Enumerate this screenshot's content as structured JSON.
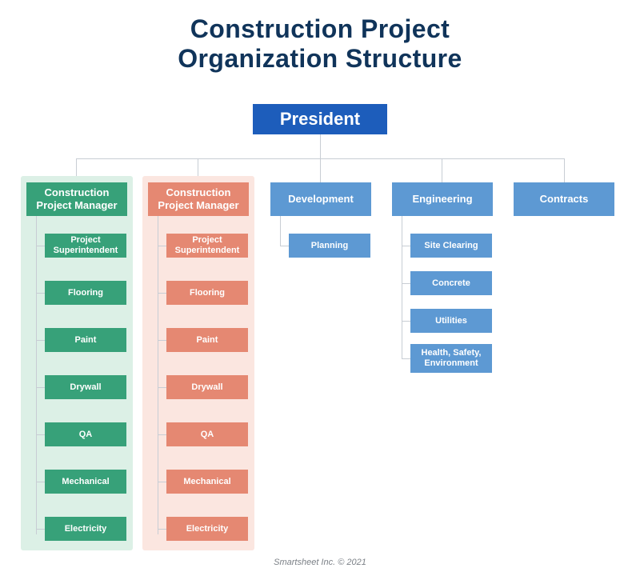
{
  "title_line1": "Construction Project",
  "title_line2": "Organization Structure",
  "president": "President",
  "columns": {
    "cpm1": {
      "label": "Construction Project Manager",
      "children": [
        "Project Superintendent",
        "Flooring",
        "Paint",
        "Drywall",
        "QA",
        "Mechanical",
        "Electricity"
      ]
    },
    "cpm2": {
      "label": "Construction Project Manager",
      "children": [
        "Project Superintendent",
        "Flooring",
        "Paint",
        "Drywall",
        "QA",
        "Mechanical",
        "Electricity"
      ]
    },
    "development": {
      "label": "Development",
      "children": [
        "Planning"
      ]
    },
    "engineering": {
      "label": "Engineering",
      "children": [
        "Site Clearing",
        "Concrete",
        "Utilities",
        "Health, Safety, Environment"
      ]
    },
    "contracts": {
      "label": "Contracts"
    }
  },
  "footer": "Smartsheet Inc. © 2021"
}
